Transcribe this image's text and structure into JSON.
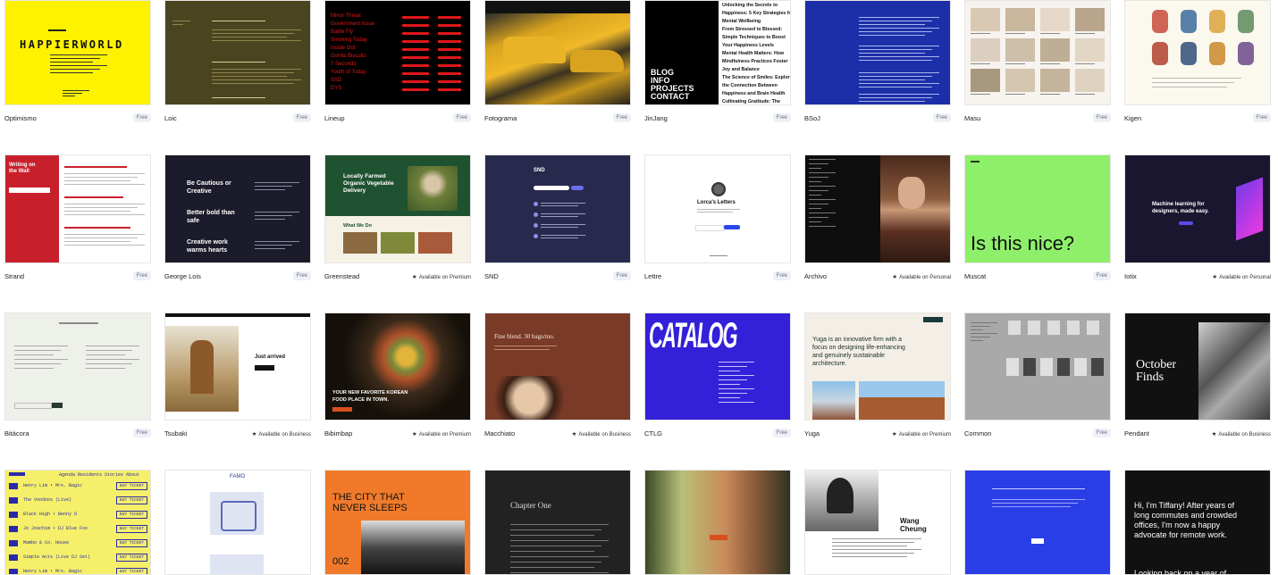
{
  "cards": [
    {
      "name": "Optimismo",
      "badge": "Free"
    },
    {
      "name": "Loic",
      "badge": "Free"
    },
    {
      "name": "Lineup",
      "badge": "Free"
    },
    {
      "name": "Fotograma",
      "badge": "Free"
    },
    {
      "name": "JinJang",
      "badge": "Free"
    },
    {
      "name": "BSoJ",
      "badge": "Free"
    },
    {
      "name": "Masu",
      "badge": "Free"
    },
    {
      "name": "Kigen",
      "badge": "Free"
    },
    {
      "name": "Strand",
      "badge": "Free"
    },
    {
      "name": "George Lois",
      "badge": "Free"
    },
    {
      "name": "Greenstead",
      "badge": "Available on Premium"
    },
    {
      "name": "SND",
      "badge": "Free"
    },
    {
      "name": "Lettre",
      "badge": "Free"
    },
    {
      "name": "Archivo",
      "badge": "Available on Personal"
    },
    {
      "name": "Muscat",
      "badge": "Free"
    },
    {
      "name": "Iotix",
      "badge": "Available on Personal"
    },
    {
      "name": "Bitácora",
      "badge": "Free"
    },
    {
      "name": "Tsubaki",
      "badge": "Available on Business"
    },
    {
      "name": "Bibimbap",
      "badge": "Available on Premium"
    },
    {
      "name": "Macchiato",
      "badge": "Available on Business"
    },
    {
      "name": "CTLG",
      "badge": "Free"
    },
    {
      "name": "Yuga",
      "badge": "Available on Premium"
    },
    {
      "name": "Common",
      "badge": "Free"
    },
    {
      "name": "Pendant",
      "badge": "Available on Business"
    }
  ],
  "previews": {
    "optimismo": {
      "title": "HAPPIERWORLD"
    },
    "jinjang": {
      "headlines": [
        "Unlocking the Secrets to",
        "Happiness: 5 Key Strategies for",
        "Mental Wellbeing",
        "From Stressed to Blessed:",
        "Simple Techniques to Boost",
        "Your Happiness Levels",
        "Mental Health Matters: How",
        "Mindfulness Practices Foster",
        "Joy and Balance",
        "The Science of Smiles: Exploring",
        "the Connection Between",
        "Happiness and Brain Health",
        "Cultivating Gratitude: The"
      ],
      "menu": [
        "BLOG",
        "INFO",
        "PROJECTS",
        "CONTACT"
      ]
    },
    "strand": {
      "title1": "Writing on",
      "title2": "the Wall"
    },
    "george": {
      "l1": "Be Cautious or",
      "l2": "Creative",
      "l3": "Better bold than",
      "l4": "safe",
      "l5": "Creative work",
      "l6": "warms hearts"
    },
    "greenstead": {
      "h1": "Locally Farmed",
      "h2": "Organic Vegetable",
      "h3": "Delivery",
      "sub": "What We Do"
    },
    "snd": {
      "title": "SND"
    },
    "lettre": {
      "title": "Lorca's Letters"
    },
    "muscat": {
      "text": "Is this nice?"
    },
    "iotix": {
      "l1": "Machine learning for",
      "l2": "designers, made easy."
    },
    "tsubaki": {
      "text": "Just arrived"
    },
    "bibimbap": {
      "l1": "YOUR NEW FAVORITE KOREAN",
      "l2": "FOOD PLACE IN TOWN."
    },
    "macchiato": {
      "l1": "Fine blend. 30 bags/mo."
    },
    "ctlg": {
      "title": "CATALOG"
    },
    "yuga": {
      "l1": "Yuga is an innovative firm with a",
      "l2": "focus on designing life-enhancing",
      "l3": "and genuinely sustainable",
      "l4": "architecture."
    },
    "pendant": {
      "l1": "October",
      "l2": "Finds"
    },
    "lineup": {
      "names": [
        "Minor Threat",
        "Government Issue",
        "Battle Fly",
        "Smoking Today",
        "Inside Out",
        "Gorilla Biscuits",
        "7 Seconds",
        "Youth of Today",
        "SSD",
        "DYS"
      ]
    },
    "row4": {
      "city1": "THE CITY THAT",
      "city2": "NEVER SLEEPS",
      "city3": "002",
      "chapter": "Chapter One",
      "wang1": "Wang",
      "wang2": "Cheung",
      "tiff1": "Hi, I'm Tiffany! After years of",
      "tiff2": "long commutes and crowded",
      "tiff3": "offices, I'm now a happy",
      "tiff4": "advocate for remote work.",
      "tiff5": "Looking back on a year of",
      "famo": "FAMO",
      "music": [
        "Henry Lim • Mrs. Bagic",
        "The Voodoos (Live)",
        "Black High • Benny D",
        "Jo Joachim • DJ Blue Fox",
        "Mambo & Co. House",
        "Simple Acts (Live DJ Set)",
        "Henry Lim • Mrs. Bagic"
      ],
      "musicBtn": "BUY TICKET",
      "musicHead": "Agenda  Residents  Stories  About"
    }
  }
}
